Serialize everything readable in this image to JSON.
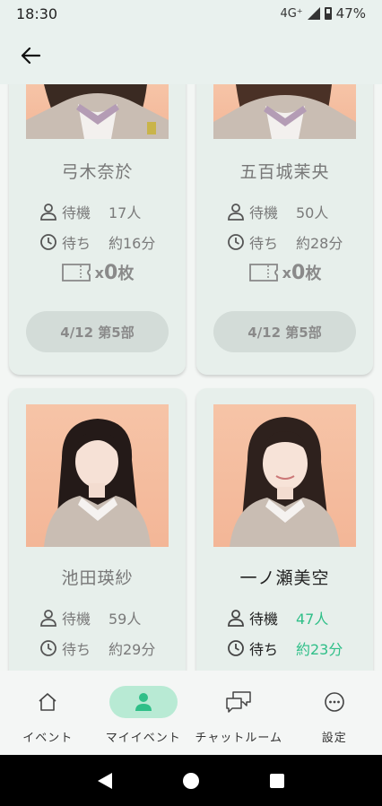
{
  "status": {
    "time": "18:30",
    "network": "4G⁺",
    "battery": "47%"
  },
  "app_bar": {
    "back_icon": "arrow-left-icon"
  },
  "cards": [
    {
      "name": "弓木奈於",
      "wait_label": "待機",
      "wait_count": "17人",
      "time_label": "待ち",
      "time_value": "約16分",
      "ticket_x": "x",
      "ticket_count": "0",
      "ticket_unit": "枚",
      "session": "4/12 第5部",
      "active": false
    },
    {
      "name": "五百城茉央",
      "wait_label": "待機",
      "wait_count": "50人",
      "time_label": "待ち",
      "time_value": "約28分",
      "ticket_x": "x",
      "ticket_count": "0",
      "ticket_unit": "枚",
      "session": "4/12 第5部",
      "active": false
    },
    {
      "name": "池田瑛紗",
      "wait_label": "待機",
      "wait_count": "59人",
      "time_label": "待ち",
      "time_value": "約29分",
      "active": false
    },
    {
      "name": "一ノ瀬美空",
      "wait_label": "待機",
      "wait_count": "47人",
      "time_label": "待ち",
      "time_value": "約23分",
      "active": true
    }
  ],
  "nav": [
    {
      "label": "イベント",
      "icon": "home-icon",
      "active": false
    },
    {
      "label": "マイイベント",
      "icon": "person-icon",
      "active": true
    },
    {
      "label": "チャットルーム",
      "icon": "chat-icon",
      "active": false
    },
    {
      "label": "設定",
      "icon": "more-icon",
      "active": false
    }
  ],
  "colors": {
    "accent": "#2fbf88",
    "nav_active_bg": "#b8ead4",
    "background": "#e9f1ee"
  }
}
